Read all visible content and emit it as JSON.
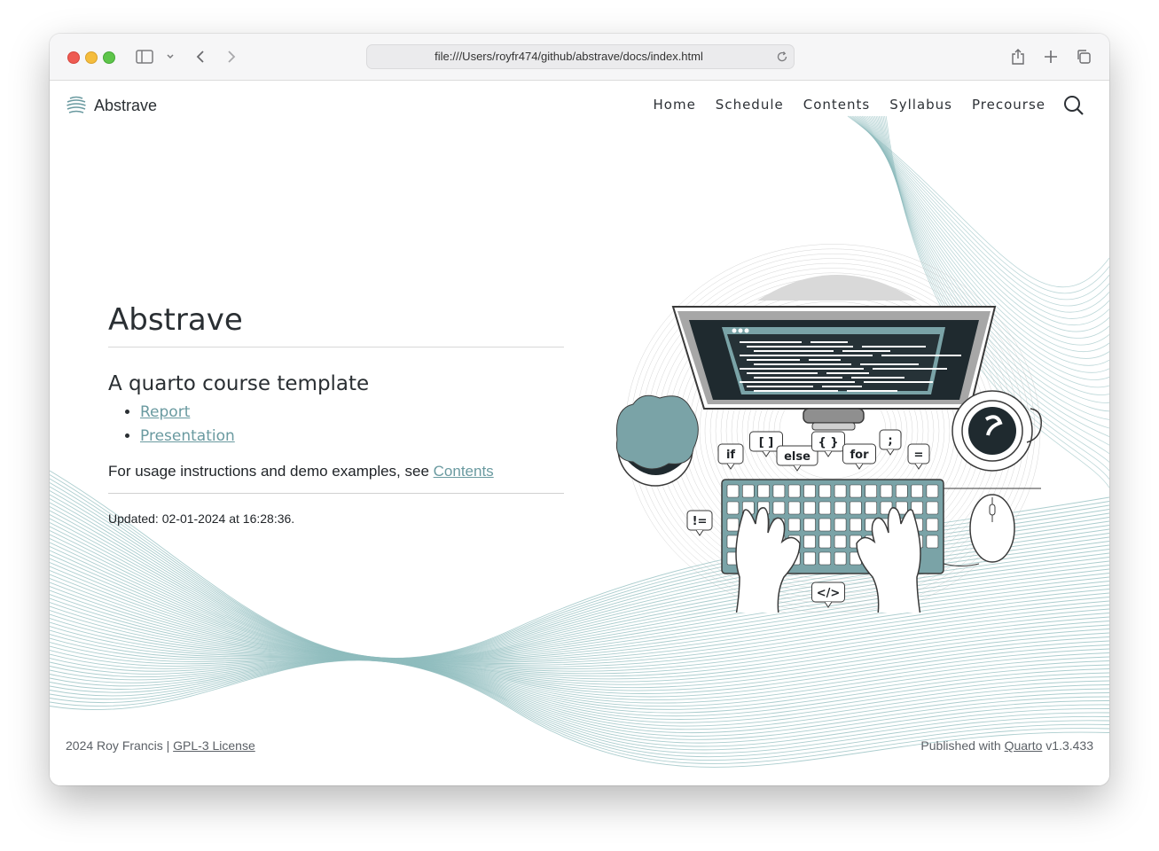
{
  "browser": {
    "url": "file:///Users/royfr474/github/abstrave/docs/index.html"
  },
  "navbar": {
    "brand": "Abstrave",
    "links": [
      "Home",
      "Schedule",
      "Contents",
      "Syllabus",
      "Precourse"
    ]
  },
  "main": {
    "title": "Abstrave",
    "subtitle": "A quarto course template",
    "links": [
      "Report",
      "Presentation"
    ],
    "usage_text": "For usage instructions and demo examples, see ",
    "usage_link": "Contents",
    "updated": "Updated: 02-01-2024 at 16:28:36."
  },
  "illustration": {
    "tags": [
      "if",
      "[ ]",
      "else",
      "{ }",
      "for",
      ";",
      "=",
      "!=",
      "</>"
    ]
  },
  "footer": {
    "left_text": "2024 Roy Francis | ",
    "left_link": "GPL-3 License",
    "right_text": "Published with ",
    "right_link": "Quarto",
    "right_version": " v1.3.433"
  },
  "colors": {
    "accent": "#6a9aa0",
    "wave": "#8fbcbe",
    "text": "#2a2f33"
  }
}
